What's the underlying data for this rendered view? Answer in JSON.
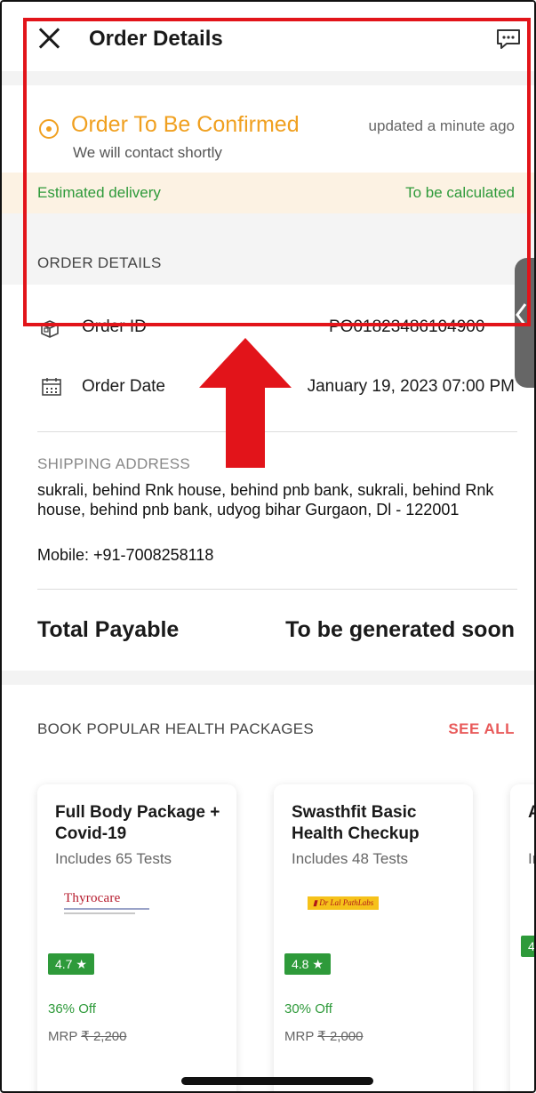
{
  "header": {
    "title": "Order Details",
    "close_icon": "close-icon",
    "chat_icon": "chat-icon"
  },
  "status": {
    "title": "Order To Be Confirmed",
    "subtitle": "We will contact shortly",
    "updated": "updated a minute ago",
    "color": "#f0a020"
  },
  "estimate": {
    "label": "Estimated delivery",
    "value": "To be calculated",
    "color": "#2e9a3a"
  },
  "order_details": {
    "heading": "ORDER DETAILS",
    "order_id_label": "Order ID",
    "order_id_value": "PO01823486104900",
    "order_date_label": "Order Date",
    "order_date_value": "January 19, 2023 07:00 PM"
  },
  "shipping": {
    "label": "SHIPPING ADDRESS",
    "address": "sukrali, behind Rnk house, behind pnb bank, sukrali, behind Rnk house, behind pnb bank, udyog bihar Gurgaon, Dl - 122001",
    "mobile": "Mobile: +91-7008258118"
  },
  "total": {
    "label": "Total Payable",
    "value": "To be generated soon"
  },
  "packages": {
    "heading": "BOOK POPULAR HEALTH PACKAGES",
    "see_all": "SEE ALL",
    "items": [
      {
        "name": "Full Body Package + Covid-19",
        "tests": "Includes 65 Tests",
        "brand": "Thyrocare",
        "rating": "4.7 ★",
        "off": "36% Off",
        "mrp_label": "MRP",
        "mrp": "₹ 2,200"
      },
      {
        "name": "Swasthfit Basic Health Checkup",
        "tests": "Includes 48 Tests",
        "brand": "Dr Lal PathLabs",
        "rating": "4.8 ★",
        "off": "30% Off",
        "mrp_label": "MRP",
        "mrp": "₹ 2,000"
      },
      {
        "name": "A",
        "tests": "In",
        "rating": "4"
      }
    ]
  },
  "accent_colors": {
    "highlight": "#e2141a",
    "see_all": "#e85a5a"
  }
}
